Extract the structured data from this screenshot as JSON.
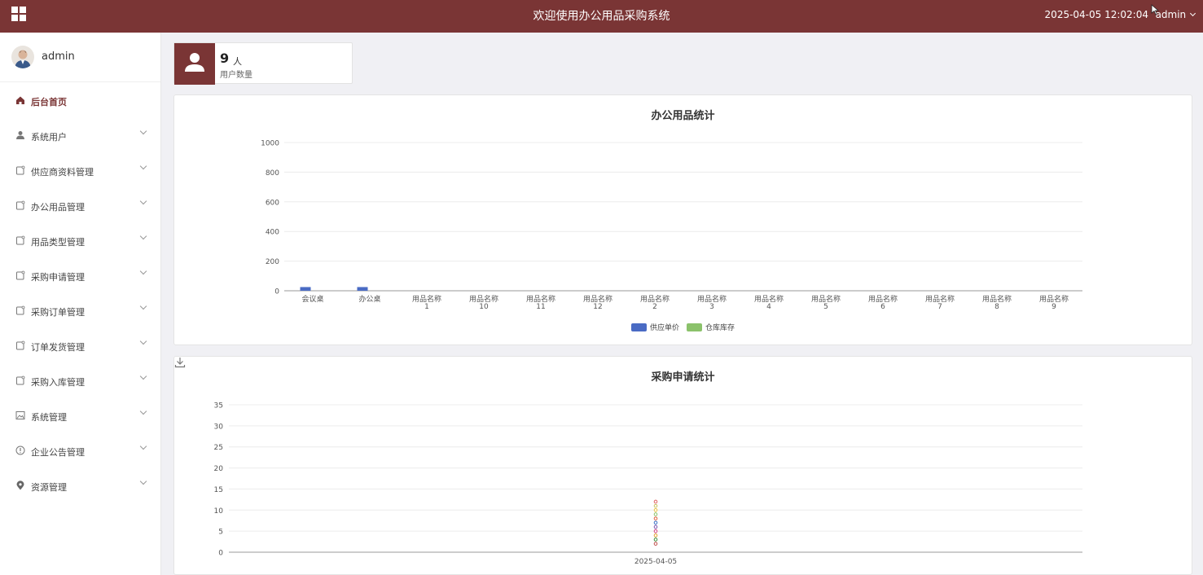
{
  "header": {
    "title": "欢迎使用办公用品采购系统",
    "datetime": "2025-04-05 12:02:04",
    "user_menu": "admin",
    "menu_icon": "grid-icon"
  },
  "sidebar": {
    "username": "admin",
    "items": [
      {
        "label": "后台首页",
        "icon": "home-icon",
        "active": true
      },
      {
        "label": "系统用户",
        "icon": "user-icon"
      },
      {
        "label": "供应商资料管理",
        "icon": "tag-icon"
      },
      {
        "label": "办公用品管理",
        "icon": "tag-icon"
      },
      {
        "label": "用品类型管理",
        "icon": "tag-icon"
      },
      {
        "label": "采购申请管理",
        "icon": "tag-icon"
      },
      {
        "label": "采购订单管理",
        "icon": "tag-icon"
      },
      {
        "label": "订单发货管理",
        "icon": "tag-icon"
      },
      {
        "label": "采购入库管理",
        "icon": "tag-icon"
      },
      {
        "label": "系统管理",
        "icon": "image-icon"
      },
      {
        "label": "企业公告管理",
        "icon": "info-icon"
      },
      {
        "label": "资源管理",
        "icon": "location-icon"
      }
    ]
  },
  "stat": {
    "value": "9",
    "unit": "人",
    "label": "用户数量"
  },
  "charts": {
    "supplies_title": "办公用品统计",
    "purchase_title": "采购申请统计"
  },
  "chart_data": [
    {
      "type": "bar",
      "title": "办公用品统计",
      "categories": [
        "会议桌",
        "办公桌",
        "用品名称\n1",
        "用品名称\n10",
        "用品名称\n11",
        "用品名称\n12",
        "用品名称\n2",
        "用品名称\n3",
        "用品名称\n4",
        "用品名称\n5",
        "用品名称\n6",
        "用品名称\n7",
        "用品名称\n8",
        "用品名称\n9"
      ],
      "series": [
        {
          "name": "供应单价",
          "values": [
            25,
            25,
            0,
            0,
            0,
            0,
            0,
            0,
            0,
            0,
            0,
            0,
            0,
            0
          ],
          "color": "#4a6bc4"
        },
        {
          "name": "仓库库存",
          "values": [
            0,
            0,
            0,
            0,
            0,
            0,
            0,
            0,
            0,
            0,
            0,
            0,
            0,
            0
          ],
          "color": "#8bc26b"
        }
      ],
      "ylim": [
        0,
        1000
      ],
      "yticks": [
        0,
        200,
        400,
        600,
        800,
        1000
      ],
      "legend": "bottom-center"
    },
    {
      "type": "scatter",
      "title": "采购申请统计",
      "x": [
        "2025-04-05"
      ],
      "points": [
        {
          "x": "2025-04-05",
          "y": 2,
          "color": "#c0504d"
        },
        {
          "x": "2025-04-05",
          "y": 3,
          "color": "#3a8f3a"
        },
        {
          "x": "2025-04-05",
          "y": 4,
          "color": "#e0a030"
        },
        {
          "x": "2025-04-05",
          "y": 5,
          "color": "#d04080"
        },
        {
          "x": "2025-04-05",
          "y": 6,
          "color": "#7b52ab"
        },
        {
          "x": "2025-04-05",
          "y": 7,
          "color": "#3a6fc4"
        },
        {
          "x": "2025-04-05",
          "y": 8,
          "color": "#e06040"
        },
        {
          "x": "2025-04-05",
          "y": 9,
          "color": "#8bc26b"
        },
        {
          "x": "2025-04-05",
          "y": 10,
          "color": "#e8c040"
        },
        {
          "x": "2025-04-05",
          "y": 11,
          "color": "#c8c060"
        },
        {
          "x": "2025-04-05",
          "y": 12,
          "color": "#e06060"
        }
      ],
      "ylim": [
        0,
        35
      ],
      "yticks": [
        0,
        5,
        10,
        15,
        20,
        25,
        30,
        35
      ]
    }
  ]
}
